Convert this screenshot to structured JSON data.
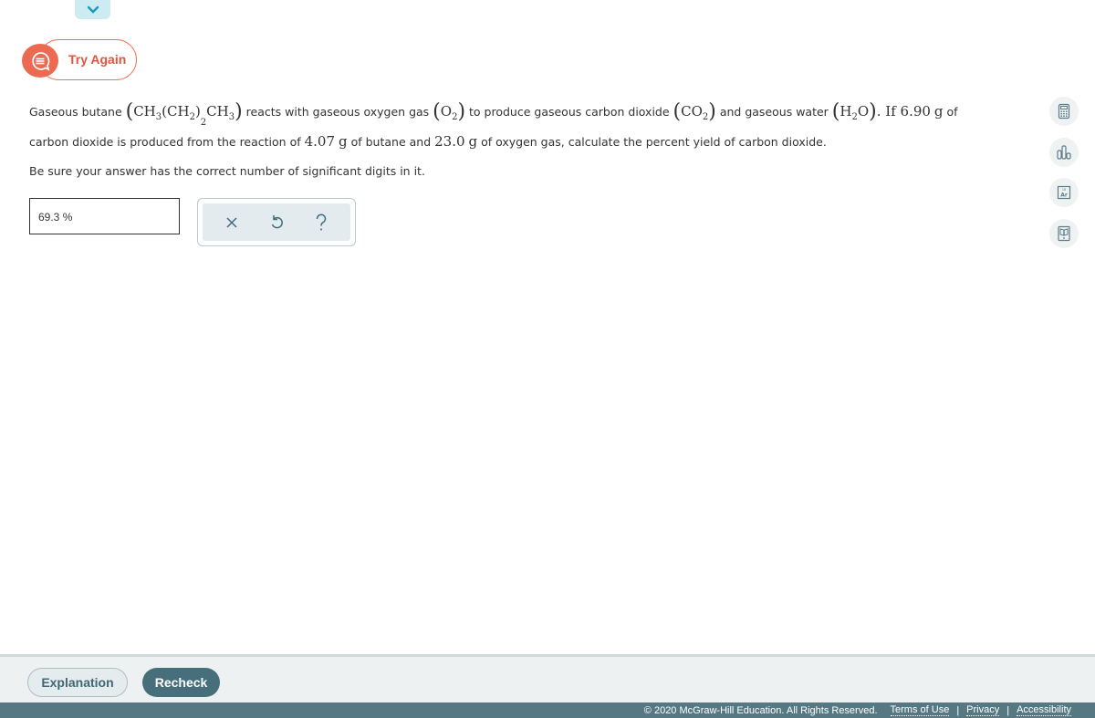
{
  "header": {
    "collapse_icon": "chevron-down-icon",
    "try_again": {
      "label": "Try Again",
      "icon": "speech-bubble-icon",
      "color": "#ec6a52"
    }
  },
  "question": {
    "line1": {
      "t1": "Gaseous butane ",
      "butane_formula": [
        "CH",
        "3",
        "(CH",
        "2",
        ")",
        "2",
        "CH",
        "3"
      ],
      "t2": " reacts with gaseous oxygen gas ",
      "oxygen_formula": [
        "O",
        "2"
      ],
      "t3": " to produce gaseous carbon dioxide ",
      "co2_formula": [
        "CO",
        "2"
      ],
      "t4": " and gaseous water ",
      "water_formula": [
        "H",
        "2",
        "O"
      ],
      "t5": ". If ",
      "co2_mass": "6.90",
      "unit_g": "g",
      "t6": " of"
    },
    "line2": {
      "t1": "carbon dioxide is produced from the reaction of ",
      "butane_mass": "4.07",
      "unit_g": "g",
      "t2": " of butane and ",
      "oxygen_mass": "23.0",
      "unit_g2": "g",
      "t3": " of oxygen gas, calculate the percent yield of carbon dioxide."
    },
    "line3": "Be sure your answer has the correct number of significant digits in it."
  },
  "answer": {
    "value": "69.3 %"
  },
  "toolbox": {
    "clear_icon": "close-icon",
    "undo_icon": "undo-icon",
    "help_icon": "help-icon"
  },
  "side_tools": [
    {
      "name": "calculator-icon"
    },
    {
      "name": "data-chart-icon"
    },
    {
      "name": "periodic-table-icon"
    },
    {
      "name": "reference-book-icon"
    }
  ],
  "side_ar": {
    "num": "18",
    "symbol": "Ar"
  },
  "bottom": {
    "explanation_label": "Explanation",
    "recheck_label": "Recheck"
  },
  "footer": {
    "copyright": "© 2020 McGraw-Hill Education. All Rights Reserved.",
    "links": [
      "Terms of Use",
      "Privacy",
      "Accessibility"
    ],
    "separator": "|"
  },
  "colors": {
    "accent_orange": "#ec6a52",
    "teal_dark": "#466e7b",
    "footer_bg": "#557883"
  }
}
